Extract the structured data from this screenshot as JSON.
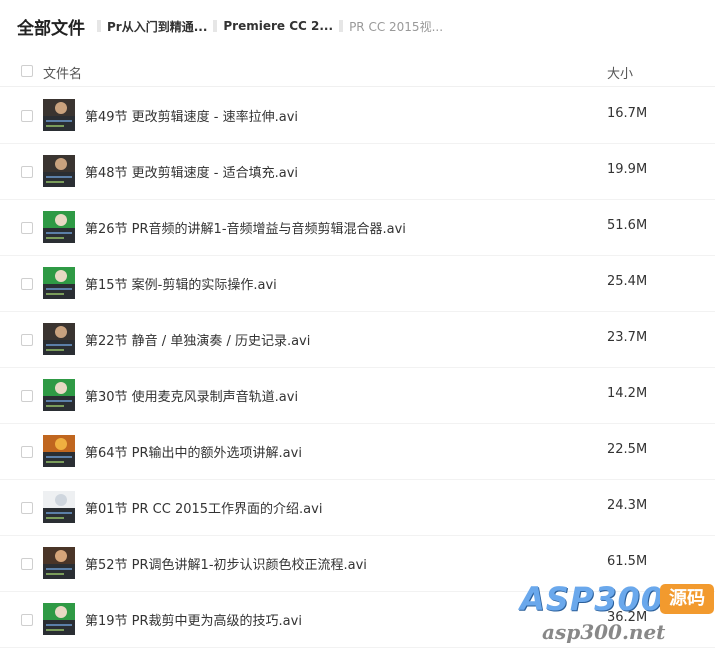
{
  "breadcrumb": {
    "root": "全部文件",
    "segments": [
      "Pr从入门到精通...",
      "Premiere CC 2...",
      "PR CC 2015视..."
    ]
  },
  "header": {
    "name_label": "文件名",
    "size_label": "大小"
  },
  "files": [
    {
      "name": "第49节 更改剪辑速度 - 速率拉伸.avi",
      "size": "16.7M",
      "thumb": "face"
    },
    {
      "name": "第48节 更改剪辑速度 - 适合填充.avi",
      "size": "19.9M",
      "thumb": "face"
    },
    {
      "name": "第26节 PR音频的讲解1-音频增益与音频剪辑混合器.avi",
      "size": "51.6M",
      "thumb": "green"
    },
    {
      "name": "第15节 案例-剪辑的实际操作.avi",
      "size": "25.4M",
      "thumb": "green"
    },
    {
      "name": "第22节 静音 / 单独演奏 / 历史记录.avi",
      "size": "23.7M",
      "thumb": "face"
    },
    {
      "name": "第30节 使用麦克风录制声音轨道.avi",
      "size": "14.2M",
      "thumb": "green"
    },
    {
      "name": "第64节 PR输出中的额外选项讲解.avi",
      "size": "22.5M",
      "thumb": "orange"
    },
    {
      "name": "第01节 PR CC 2015工作界面的介绍.avi",
      "size": "24.3M",
      "thumb": "white"
    },
    {
      "name": "第52节 PR调色讲解1-初步认识颜色校正流程.avi",
      "size": "61.5M",
      "thumb": "portrait"
    },
    {
      "name": "第19节 PR裁剪中更为高级的技巧.avi",
      "size": "36.2M",
      "thumb": "green"
    }
  ],
  "watermark": {
    "brand": "ASP300",
    "tag": "源码",
    "url": "asp300.net"
  },
  "colors": {
    "accent": "#6aa8ec",
    "tag": "#f29a2e"
  }
}
